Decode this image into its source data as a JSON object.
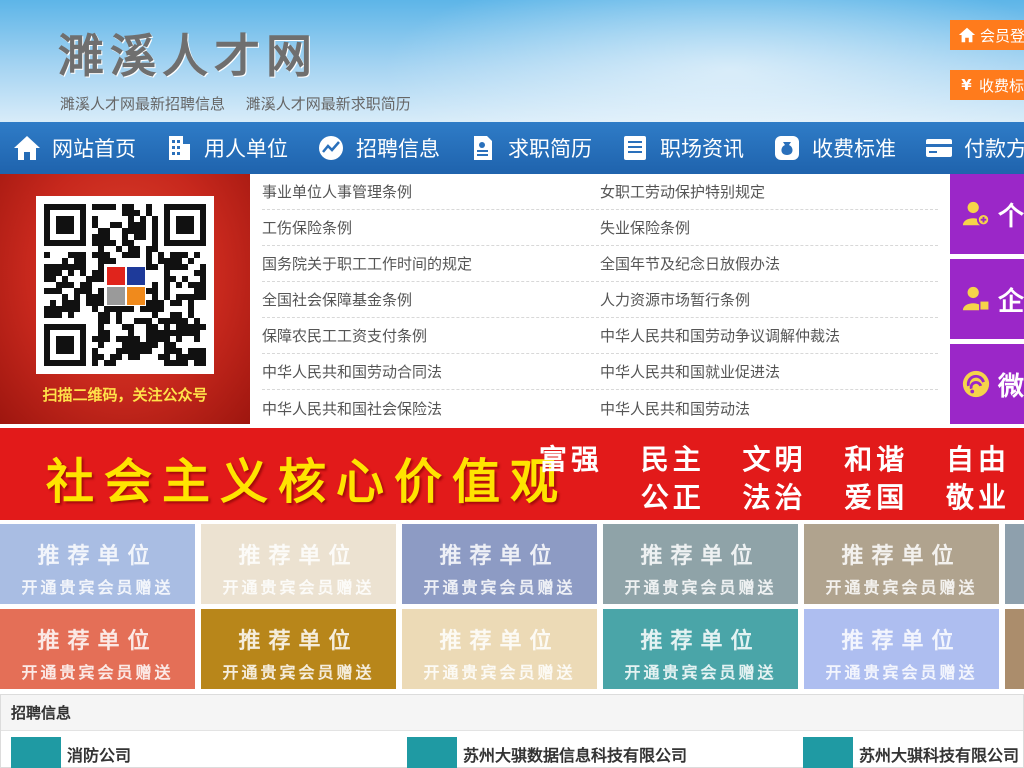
{
  "header": {
    "site_title": "濉溪人才网",
    "links": [
      "濉溪人才网最新招聘信息",
      "濉溪人才网最新求职简历"
    ],
    "login_label": "会员登",
    "fee_label": "收费标"
  },
  "nav": {
    "items": [
      {
        "label": "网站首页",
        "icon": "home-icon"
      },
      {
        "label": "用人单位",
        "icon": "building-icon"
      },
      {
        "label": "招聘信息",
        "icon": "chart-icon"
      },
      {
        "label": "求职简历",
        "icon": "resume-icon"
      },
      {
        "label": "职场资讯",
        "icon": "news-icon"
      },
      {
        "label": "收费标准",
        "icon": "moneybag-icon"
      },
      {
        "label": "付款方式",
        "icon": "card-icon"
      }
    ]
  },
  "qr": {
    "caption": "扫描二维码，关注公众号"
  },
  "laws": {
    "rows": [
      [
        "事业单位人事管理条例",
        "女职工劳动保护特别规定"
      ],
      [
        "工伤保险条例",
        "失业保险条例"
      ],
      [
        "国务院关于职工工作时间的规定",
        "全国年节及纪念日放假办法"
      ],
      [
        "全国社会保障基金条例",
        "人力资源市场暂行条例"
      ],
      [
        "保障农民工工资支付条例",
        "中华人民共和国劳动争议调解仲裁法"
      ],
      [
        "中华人民共和国劳动合同法",
        "中华人民共和国就业促进法"
      ],
      [
        "中华人民共和国社会保险法",
        "中华人民共和国劳动法"
      ]
    ]
  },
  "side": {
    "personal": "个",
    "company": "企",
    "wechat": "微"
  },
  "banner": {
    "main": "社会主义核心价值观",
    "values_row1": [
      "富强",
      "民主",
      "文明",
      "和谐",
      "自由"
    ],
    "values_row2": [
      "公正",
      "法治",
      "爱国",
      "敬业"
    ]
  },
  "recommend": {
    "title": "推荐单位",
    "subtitle": "开通贵宾会员赠送",
    "colors_row1": [
      "#a9bde3",
      "#ece2d1",
      "#8d9bc4",
      "#8fa3a8",
      "#b0a38e",
      "#8ea0ad"
    ],
    "colors_row2": [
      "#e46f57",
      "#b8861a",
      "#ecdab6",
      "#4aa5a8",
      "#aebef0",
      "#ab8d6c"
    ]
  },
  "recruit": {
    "title": "招聘信息",
    "companies": [
      "消防公司",
      "苏州大骐数据信息科技有限公司",
      "苏州大骐科技有限公司"
    ]
  }
}
